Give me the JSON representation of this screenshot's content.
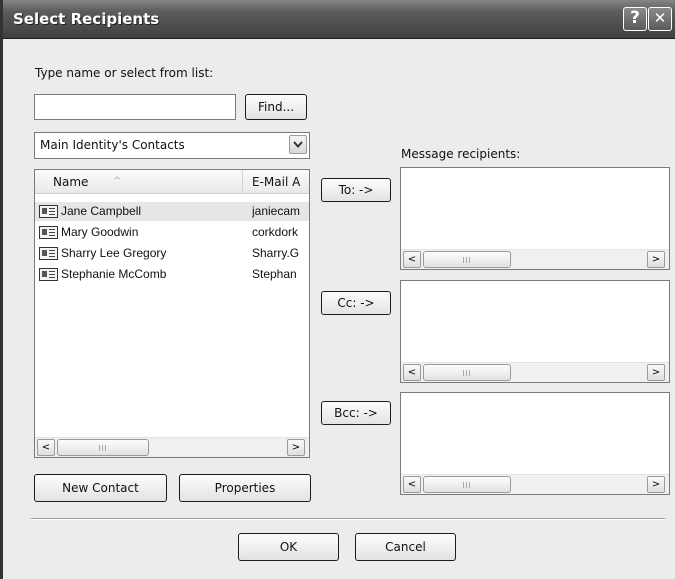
{
  "window": {
    "title": "Select Recipients",
    "help_label": "?",
    "close_label": "✕"
  },
  "search": {
    "prompt_label": "Type name or select from list:",
    "value": "",
    "find_label": "Find..."
  },
  "address_book": {
    "selected": "Main Identity's Contacts",
    "dropdown_icon": "chevron-down-icon"
  },
  "contacts": {
    "columns": {
      "name": "Name",
      "email": "E-Mail A"
    },
    "sort_indicator": "^",
    "rows": [
      {
        "name": "Jane Campbell",
        "email": "janiecam",
        "selected": true
      },
      {
        "name": "Mary Goodwin",
        "email": "corkdork",
        "selected": false
      },
      {
        "name": "Sharry Lee Gregory",
        "email": "Sharry.G",
        "selected": false
      },
      {
        "name": "Stephanie McComb",
        "email": "Stephan",
        "selected": false
      }
    ],
    "row_icon": "contact-card-icon"
  },
  "recipients": {
    "label": "Message recipients:",
    "to_label": "To: ->",
    "cc_label": "Cc: ->",
    "bcc_label": "Bcc: ->"
  },
  "actions": {
    "new_contact_label": "New Contact",
    "properties_label": "Properties",
    "ok_label": "OK",
    "cancel_label": "Cancel"
  },
  "scroll_arrows": {
    "left": "<",
    "right": ">"
  }
}
